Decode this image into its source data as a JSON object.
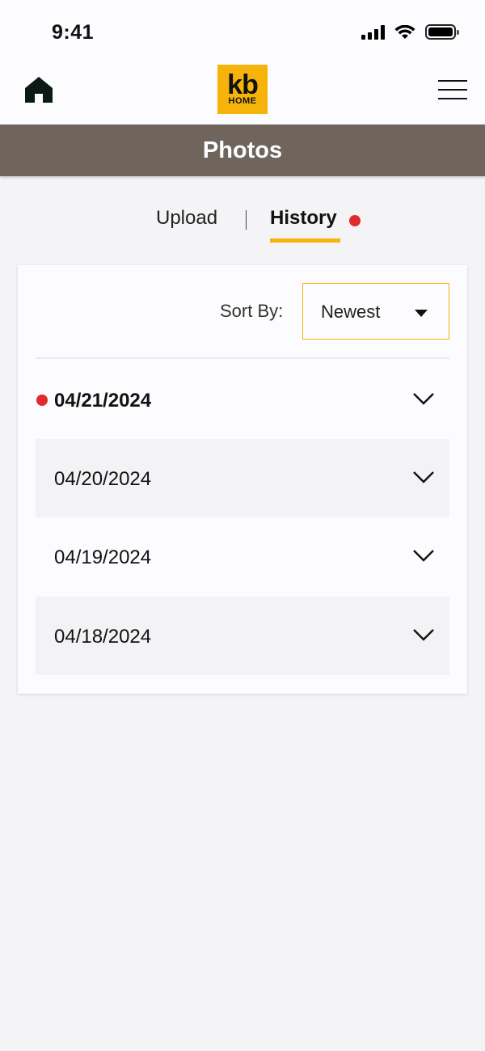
{
  "status": {
    "time": "9:41"
  },
  "header": {
    "logo_line1": "kb",
    "logo_line2": "HOME",
    "title": "Photos"
  },
  "tabs": [
    {
      "label": "Upload",
      "active": false
    },
    {
      "label": "History",
      "active": true,
      "has_notification": true
    }
  ],
  "sort": {
    "label": "Sort By:",
    "value": "Newest"
  },
  "history": [
    {
      "date": "04/21/2024",
      "unread": true
    },
    {
      "date": "04/20/2024",
      "unread": false
    },
    {
      "date": "04/19/2024",
      "unread": false
    },
    {
      "date": "04/18/2024",
      "unread": false
    }
  ],
  "colors": {
    "brand_yellow": "#f6b40b",
    "title_bar": "#6f655c",
    "notification_red": "#e02b2b"
  }
}
